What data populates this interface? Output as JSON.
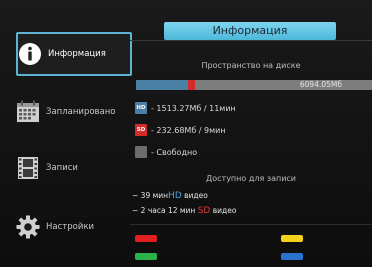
{
  "sidebar": {
    "items": [
      {
        "label": "Информация",
        "icon": "info-icon"
      },
      {
        "label": "Запланировано",
        "icon": "calendar-icon"
      },
      {
        "label": "Записи",
        "icon": "film-icon"
      },
      {
        "label": "Настройки",
        "icon": "gear-icon"
      }
    ],
    "active_index": 0
  },
  "main": {
    "title": "Информация",
    "disk_section_title": "Пространство на диске",
    "disk_total": "6094.05Мб",
    "usage": {
      "hd_fraction": 0.22,
      "sd_fraction": 0.03
    },
    "legend": {
      "hd_badge": "HD",
      "hd_text": "- 1513.27Мб / 11мин",
      "sd_badge": "SD",
      "sd_text": "- 232.68Мб / 9мин",
      "free_text": "- Свободно"
    },
    "available_section_title": "Доступно для записи",
    "available": {
      "hd_prefix": "~ 39 мин",
      "hd_label": "HD",
      "hd_suffix": " видео",
      "sd_prefix": "~ 2 часа 12 мин ",
      "sd_label": "SD",
      "sd_suffix": " видео"
    }
  },
  "color_buttons": {
    "red": "#e02020",
    "yellow": "#f2d21a",
    "green": "#2bb34a",
    "blue": "#2a74d0"
  }
}
